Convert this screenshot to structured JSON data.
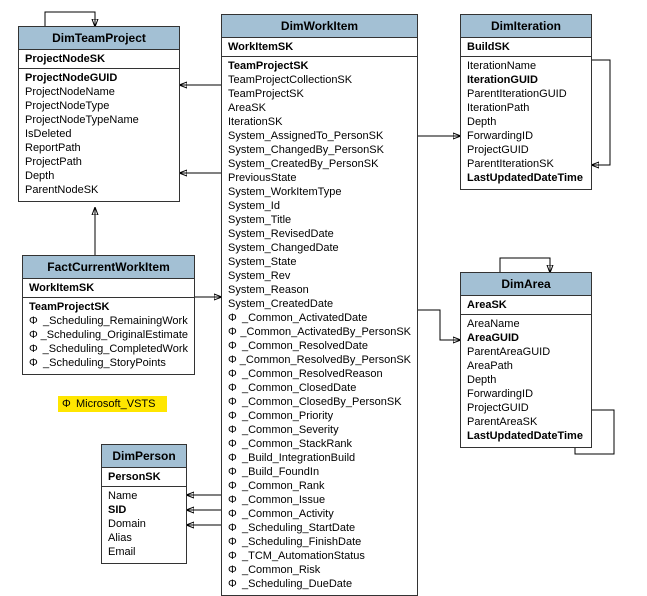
{
  "phi": "Φ",
  "legend": {
    "label": "Microsoft_VSTS"
  },
  "entities": {
    "dimTeamProject": {
      "title": "DimTeamProject",
      "pk": "ProjectNodeSK",
      "fields": [
        {
          "label": "ProjectNodeGUID",
          "bold": true
        },
        {
          "label": "ProjectNodeName"
        },
        {
          "label": "ProjectNodeType"
        },
        {
          "label": "ProjectNodeTypeName"
        },
        {
          "label": "IsDeleted"
        },
        {
          "label": "ReportPath"
        },
        {
          "label": "ProjectPath"
        },
        {
          "label": "Depth"
        },
        {
          "label": "ParentNodeSK"
        }
      ]
    },
    "factCurrentWorkItem": {
      "title": "FactCurrentWorkItem",
      "pk": "WorkItemSK",
      "fields": [
        {
          "label": "TeamProjectSK",
          "bold": true
        },
        {
          "label": "_Scheduling_RemainingWork",
          "phi": true
        },
        {
          "label": "_Scheduling_OriginalEstimate",
          "phi": true
        },
        {
          "label": "_Scheduling_CompletedWork",
          "phi": true
        },
        {
          "label": "_Scheduling_StoryPoints",
          "phi": true
        }
      ]
    },
    "dimPerson": {
      "title": "DimPerson",
      "pk": "PersonSK",
      "fields": [
        {
          "label": "Name"
        },
        {
          "label": "SID",
          "bold": true
        },
        {
          "label": "Domain"
        },
        {
          "label": "Alias"
        },
        {
          "label": "Email"
        }
      ]
    },
    "dimWorkItem": {
      "title": "DimWorkItem",
      "pk": "WorkItemSK",
      "fields": [
        {
          "label": "TeamProjectSK",
          "bold": true
        },
        {
          "label": "TeamProjectCollectionSK"
        },
        {
          "label": "TeamProjectSK"
        },
        {
          "label": "AreaSK"
        },
        {
          "label": "IterationSK"
        },
        {
          "label": "System_AssignedTo_PersonSK"
        },
        {
          "label": "System_ChangedBy_PersonSK"
        },
        {
          "label": "System_CreatedBy_PersonSK"
        },
        {
          "label": "PreviousState"
        },
        {
          "label": "System_WorkItemType"
        },
        {
          "label": "System_Id"
        },
        {
          "label": "System_Title"
        },
        {
          "label": "System_RevisedDate"
        },
        {
          "label": "System_ChangedDate"
        },
        {
          "label": "System_State"
        },
        {
          "label": "System_Rev"
        },
        {
          "label": "System_Reason"
        },
        {
          "label": "System_CreatedDate"
        },
        {
          "label": "_Common_ActivatedDate",
          "phi": true
        },
        {
          "label": "_Common_ActivatedBy_PersonSK",
          "phi": true
        },
        {
          "label": "_Common_ResolvedDate",
          "phi": true
        },
        {
          "label": "_Common_ResolvedBy_PersonSK",
          "phi": true
        },
        {
          "label": "_Common_ResolvedReason",
          "phi": true
        },
        {
          "label": "_Common_ClosedDate",
          "phi": true
        },
        {
          "label": "_Common_ClosedBy_PersonSK",
          "phi": true
        },
        {
          "label": "_Common_Priority",
          "phi": true
        },
        {
          "label": "_Common_Severity",
          "phi": true
        },
        {
          "label": "_Common_StackRank",
          "phi": true
        },
        {
          "label": "_Build_IntegrationBuild",
          "phi": true
        },
        {
          "label": "_Build_FoundIn",
          "phi": true
        },
        {
          "label": "_Common_Rank",
          "phi": true
        },
        {
          "label": "_Common_Issue",
          "phi": true
        },
        {
          "label": "_Common_Activity",
          "phi": true
        },
        {
          "label": "_Scheduling_StartDate",
          "phi": true
        },
        {
          "label": "_Scheduling_FinishDate",
          "phi": true
        },
        {
          "label": "_TCM_AutomationStatus",
          "phi": true
        },
        {
          "label": "_Common_Risk",
          "phi": true
        },
        {
          "label": "_Scheduling_DueDate",
          "phi": true
        }
      ]
    },
    "dimIteration": {
      "title": "DimIteration",
      "pk": "BuildSK",
      "fields": [
        {
          "label": "IterationName"
        },
        {
          "label": "IterationGUID",
          "bold": true
        },
        {
          "label": "ParentIterationGUID"
        },
        {
          "label": "IterationPath"
        },
        {
          "label": "Depth"
        },
        {
          "label": "ForwardingID"
        },
        {
          "label": "ProjectGUID"
        },
        {
          "label": "ParentIterationSK"
        },
        {
          "label": "LastUpdatedDateTime",
          "bold": true
        }
      ]
    },
    "dimArea": {
      "title": "DimArea",
      "pk": "AreaSK",
      "fields": [
        {
          "label": "AreaName"
        },
        {
          "label": "AreaGUID",
          "bold": true
        },
        {
          "label": "ParentAreaGUID"
        },
        {
          "label": "AreaPath"
        },
        {
          "label": "Depth"
        },
        {
          "label": "ForwardingID"
        },
        {
          "label": "ProjectGUID"
        },
        {
          "label": "ParentAreaSK"
        },
        {
          "label": "LastUpdatedDateTime",
          "bold": true
        }
      ]
    }
  }
}
